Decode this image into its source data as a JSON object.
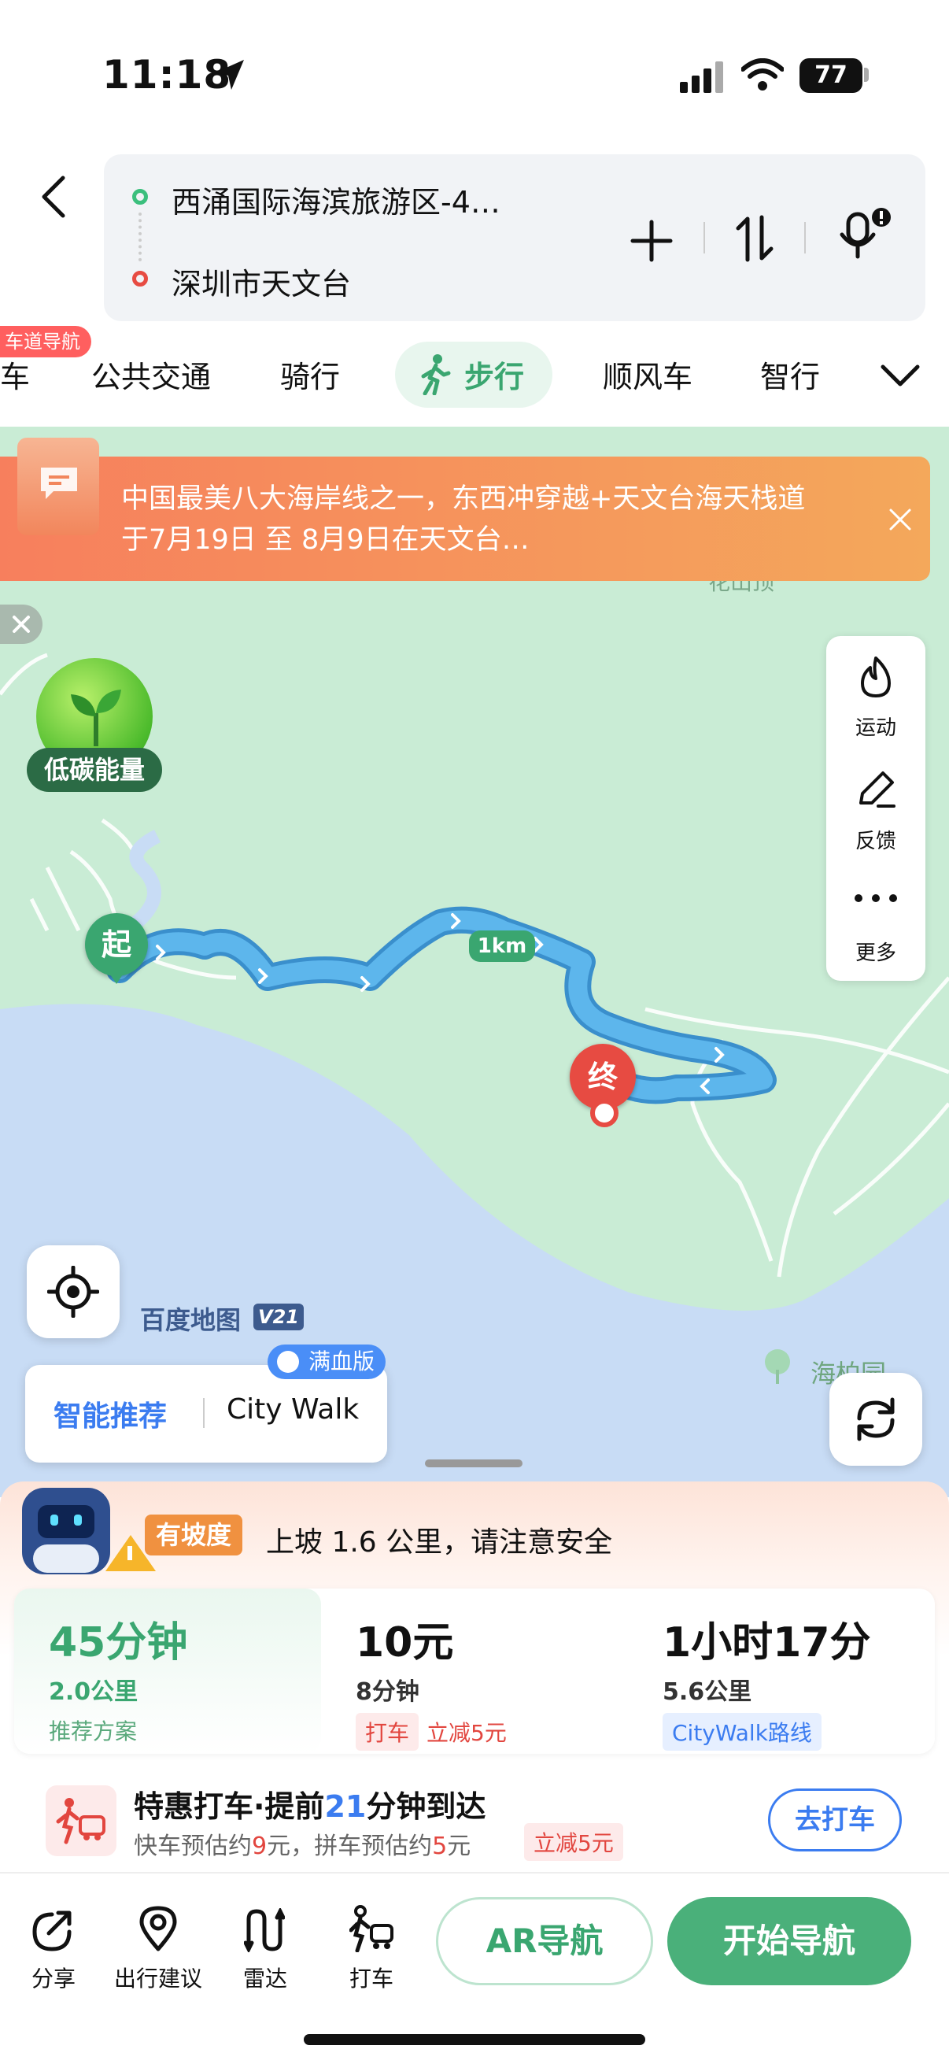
{
  "status": {
    "time": "11:18",
    "battery": "77"
  },
  "route": {
    "origin": "西涌国际海滨旅游区-4…",
    "destination": "深圳市天文台"
  },
  "modes": {
    "badge": "车道导航",
    "items": [
      "车",
      "公共交通",
      "骑行",
      "步行",
      "顺风车",
      "智行"
    ],
    "active": "步行"
  },
  "notice": {
    "text": "中国最美八大海岸线之一，东西冲穿越+天文台海天栈道于7月19日 至 8月9日在天文台…"
  },
  "map": {
    "poi_top": "花山顶",
    "poi_bottom": "海柏园",
    "energy_label": "低碳能量",
    "start_marker": "起",
    "end_marker": "终",
    "km_marker": "1km",
    "brand": "百度地图",
    "brand_version": "V21",
    "side_panel": [
      {
        "icon": "flame-icon",
        "label": "运动"
      },
      {
        "icon": "feedback-icon",
        "label": "反馈"
      },
      {
        "icon": "more-icon",
        "label": "更多"
      }
    ],
    "reco": {
      "tab1": "智能推荐",
      "tab2": "City Walk",
      "badge": "满血版"
    }
  },
  "sheet": {
    "slope_tag": "有坡度",
    "slope_text": "上坡 1.6 公里，请注意安全",
    "plans": [
      {
        "time": "45分钟",
        "distance": "2.0公里",
        "note": "推荐方案"
      },
      {
        "price": "10元",
        "duration": "8分钟",
        "tag1": "打车",
        "tag2": "立减5元"
      },
      {
        "time": "1小时17分",
        "distance": "5.6公里",
        "tag": "CityWalk路线"
      }
    ],
    "taxi": {
      "title_prefix": "特惠打车·提前",
      "title_num": "21",
      "title_suffix": "分钟到达",
      "sub_a": "快车预估约",
      "sub_a_num": "9",
      "sub_a_unit": "元，拼车预估约",
      "sub_b_num": "5",
      "sub_b_unit": "元",
      "promo": "立减5元",
      "button": "去打车"
    }
  },
  "bottom": {
    "items": [
      "分享",
      "出行建议",
      "雷达",
      "打车"
    ],
    "ar_button": "AR导航",
    "start_button": "开始导航"
  },
  "colors": {
    "accent": "#4ab07a",
    "route": "#5db6ec",
    "map_land": "#c9ecd5",
    "sea": "#c8dcf5",
    "notice": "#f48c5a"
  }
}
